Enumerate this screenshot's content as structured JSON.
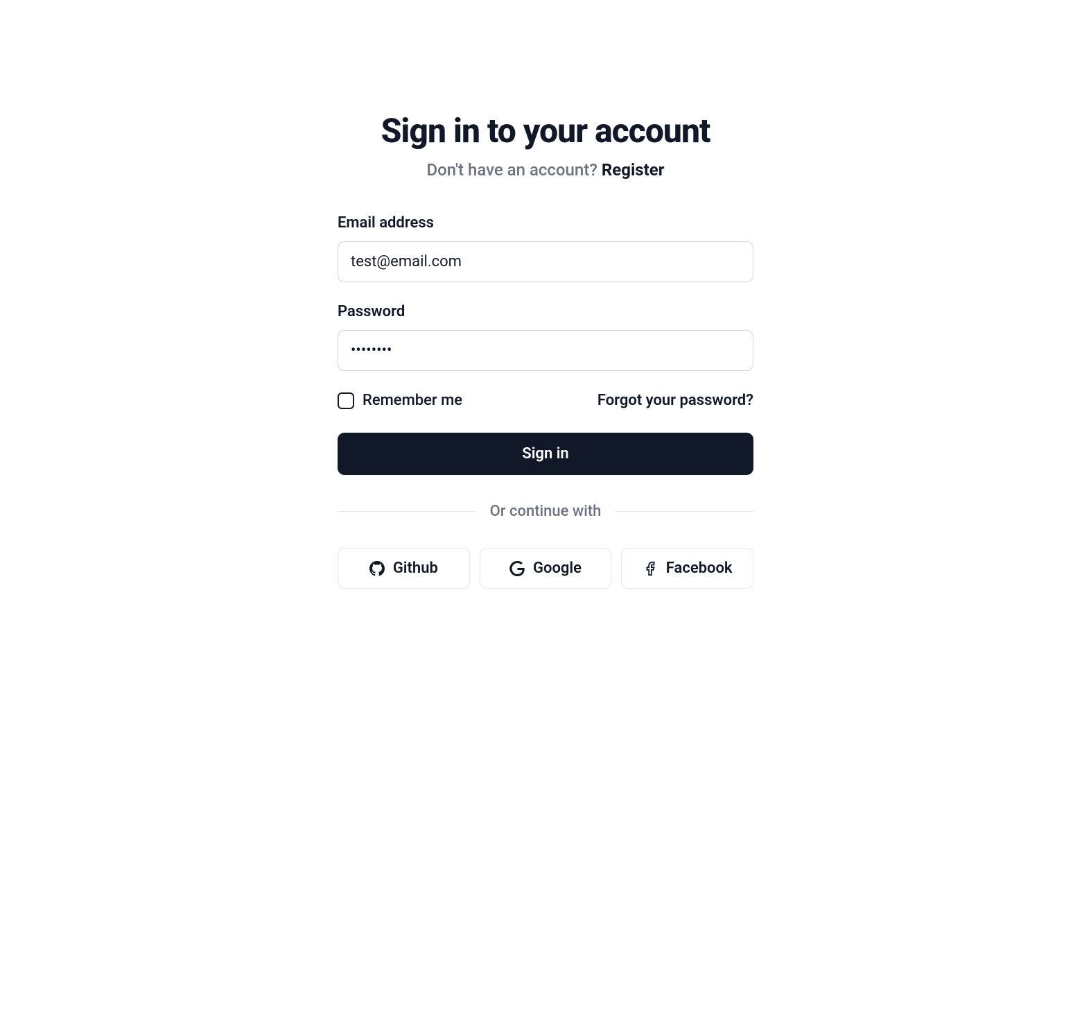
{
  "header": {
    "title": "Sign in to your account",
    "subtitle_prefix": "Don't have an account? ",
    "register_link": "Register"
  },
  "form": {
    "email_label": "Email address",
    "email_value": "test@email.com",
    "password_label": "Password",
    "password_value": "••••••••",
    "remember_label": "Remember me",
    "forgot_link": "Forgot your password?",
    "submit_label": "Sign in"
  },
  "divider": {
    "text": "Or continue with"
  },
  "social": {
    "github_label": "Github",
    "google_label": "Google",
    "facebook_label": "Facebook"
  }
}
